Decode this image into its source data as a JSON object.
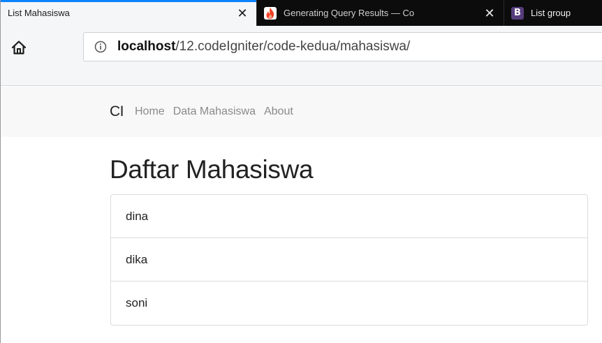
{
  "browser": {
    "tabs": [
      {
        "title": "List Mahasiswa",
        "icon": "none",
        "active": true
      },
      {
        "title": "Generating Query Results — Co",
        "icon": "codeigniter-flame-icon",
        "active": false
      },
      {
        "title": "List group",
        "icon": "bootstrap-icon",
        "icon_letter": "B",
        "active": false
      }
    ],
    "close_glyph": "✕",
    "url": {
      "host": "localhost",
      "path": "/12.codeIgniter/code-kedua/mahasiswa/"
    }
  },
  "navbar": {
    "brand": "CI",
    "links": [
      "Home",
      "Data Mahasiswa",
      "About"
    ]
  },
  "page": {
    "title": "Daftar Mahasiswa",
    "students": [
      "dina",
      "dika",
      "soni"
    ]
  },
  "colors": {
    "tab_strip": "#0c0c0d",
    "active_tab_accent": "#0a84ff",
    "codeigniter": "#ee4323",
    "bootstrap": "#563d7c"
  }
}
